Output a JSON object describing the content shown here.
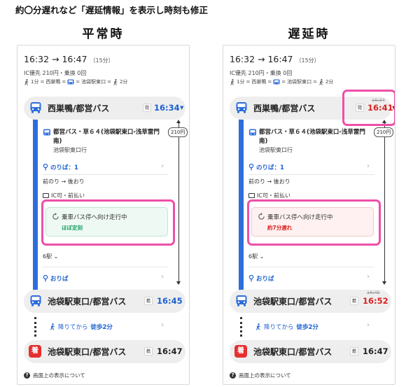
{
  "header_note": "約〇分遅れなど「遅延情報」を表示し時刻も修正",
  "columns": {
    "normal": {
      "title": "平常時",
      "status": {
        "main": "乗車バス停へ向け走行中",
        "sub": "ほぼ定刻"
      },
      "depart_time": "16:34",
      "arrive_time": "16:45"
    },
    "delayed": {
      "title": "遅延時",
      "status": {
        "main": "乗車バス停へ向け走行中",
        "sub": "約7分遅れ"
      },
      "depart_time": "16:41",
      "depart_time_original": "16:34",
      "arrive_time": "16:52",
      "arrive_time_original": "16:45"
    }
  },
  "summary": {
    "depart": "16:32",
    "arrow": "→",
    "arrive": "16:47",
    "duration": "（15分）",
    "fare": "IC優先 210円・乗換 0回",
    "walk1": "1分",
    "from_stop": "西巣鴨",
    "to_stop": "池袋駅東口",
    "walk2": "2分",
    "eq": "="
  },
  "route": {
    "board_stop": "西巣鴨/都営バス",
    "depart_badge": "発",
    "fare_tag": "210円",
    "line_name": "都営バス・草６４(池袋駅東口-浅草雷門南)",
    "line_dest": "池袋駅東口行",
    "board_platform": "のりば：1",
    "door_info": "前のり → 後おり",
    "payment_info": "IC可・前払い",
    "stations": "6駅",
    "alight_platform": "おりば",
    "alight_stop": "池袋駅東口/都営バス",
    "arrive_badge": "着",
    "walk_text": "降りてから",
    "walk_time": "徒歩2分",
    "dest_stop": "池袋駅東口/都営バス",
    "dest_badge": "着",
    "dest_icon": "着",
    "dest_time": "16:47",
    "footer": "画面上の表示について",
    "footer_icon": "?"
  },
  "colors": {
    "accent_blue": "#2d6ddc",
    "delay_red": "#d92020",
    "ontime_green": "#1ea166",
    "highlight_pink": "#ee4fa8"
  },
  "icons": [
    "bus-icon",
    "walk-icon",
    "platform-icon",
    "chevron-right-icon",
    "refresh-icon",
    "card-icon",
    "arrive-icon",
    "question-icon"
  ]
}
